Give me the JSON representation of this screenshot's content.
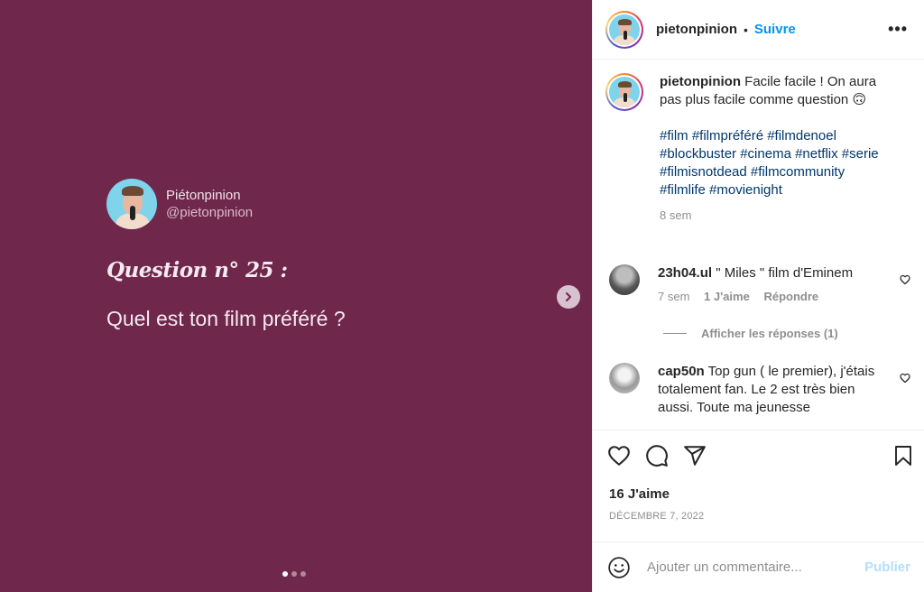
{
  "post": {
    "author_name": "Piétonpinion",
    "author_handle": "@pietonpinion",
    "question_title": "Question n° 25 :",
    "question_text": "Quel est ton film préféré ?",
    "carousel": {
      "slides": 3,
      "current": 1
    }
  },
  "header": {
    "username": "pietonpinion",
    "separator": "•",
    "follow_label": "Suivre",
    "more_label": "•••"
  },
  "caption": {
    "username": "pietonpinion",
    "text": "Facile facile ! On aura pas plus facile comme question 🙃",
    "hashtags": "#film #filmpréféré #filmdenoel #blockbuster #cinema #netflix #serie #filmisnotdead #filmcommunity #filmlife #movienight",
    "time": "8 sem"
  },
  "comments": [
    {
      "username": "23h04.ul",
      "text": "\" Miles \" film d'Eminem",
      "time": "7 sem",
      "likes": "1 J'aime",
      "reply": "Répondre"
    },
    {
      "username": "cap50n",
      "text": "Top gun ( le premier), j'étais totalement fan. Le 2 est très bien aussi. Toute ma jeunesse"
    }
  ],
  "show_replies": "Afficher les réponses (1)",
  "likes_count": "16 J'aime",
  "date": "DÉCEMBRE 7, 2022",
  "add_comment": {
    "placeholder": "Ajouter un commentaire...",
    "publish_label": "Publier"
  },
  "colors": {
    "media_background": "#6f274c",
    "link_blue": "#0095f6",
    "hashtag_blue": "#00376b"
  }
}
